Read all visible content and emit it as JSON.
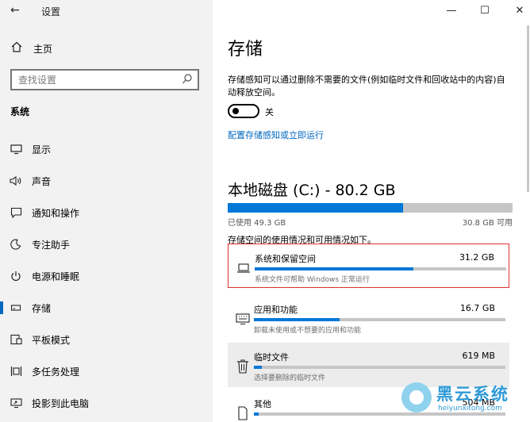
{
  "window": {
    "title": "设置",
    "back_icon": "←",
    "min_icon": "—",
    "max_icon": "☐",
    "close_icon": "✕"
  },
  "sidebar": {
    "home": {
      "label": "主页",
      "icon": "home-icon"
    },
    "search_placeholder": "查找设置",
    "section_title": "系统",
    "items": [
      {
        "label": "显示",
        "icon": "display-icon",
        "active": false
      },
      {
        "label": "声音",
        "icon": "sound-icon",
        "active": false
      },
      {
        "label": "通知和操作",
        "icon": "notification-icon",
        "active": false
      },
      {
        "label": "专注助手",
        "icon": "focus-assist-icon",
        "active": false
      },
      {
        "label": "电源和睡眠",
        "icon": "power-icon",
        "active": false
      },
      {
        "label": "存储",
        "icon": "storage-icon",
        "active": true
      },
      {
        "label": "平板模式",
        "icon": "tablet-mode-icon",
        "active": false
      },
      {
        "label": "多任务处理",
        "icon": "multitasking-icon",
        "active": false
      },
      {
        "label": "投影到此电脑",
        "icon": "projection-icon",
        "active": false
      }
    ]
  },
  "main": {
    "title": "存储",
    "description": "存储感知可以通过删除不需要的文件(例如临时文件和回收站中的内容)自动释放空间。",
    "toggle": {
      "state_label": "关",
      "on": false
    },
    "configure_link": "配置存储感知或立即运行",
    "disk": {
      "title": "本地磁盘 (C:) - 80.2 GB",
      "used_label": "已使用 49.3 GB",
      "free_label": "30.8 GB 可用",
      "used_fraction": 0.615
    },
    "usage_title": "存储空间的使用情况和可用情况如下。",
    "categories": [
      {
        "name": "系统和保留空间",
        "size": "31.2 GB",
        "sub": "系统文件可帮助 Windows 正常运行",
        "fraction": 0.63,
        "icon": "laptop-icon",
        "highlighted": true
      },
      {
        "name": "应用和功能",
        "size": "16.7 GB",
        "sub": "卸载未使用或不想要的应用和功能",
        "fraction": 0.34,
        "icon": "keyboard-icon",
        "highlighted": false
      },
      {
        "name": "临时文件",
        "size": "619 MB",
        "sub": "选择要删除的临时文件",
        "fraction": 0.03,
        "icon": "trash-icon",
        "highlighted": false
      },
      {
        "name": "其他",
        "size": "504 MB",
        "sub": "",
        "fraction": 0.02,
        "icon": "file-icon",
        "highlighted": false
      }
    ]
  },
  "watermark": {
    "title": "黑云系统",
    "url": "heiyunxitong.com"
  },
  "colors": {
    "accent": "#0078d7",
    "link": "#0067c0",
    "highlight_border": "#e03030"
  }
}
